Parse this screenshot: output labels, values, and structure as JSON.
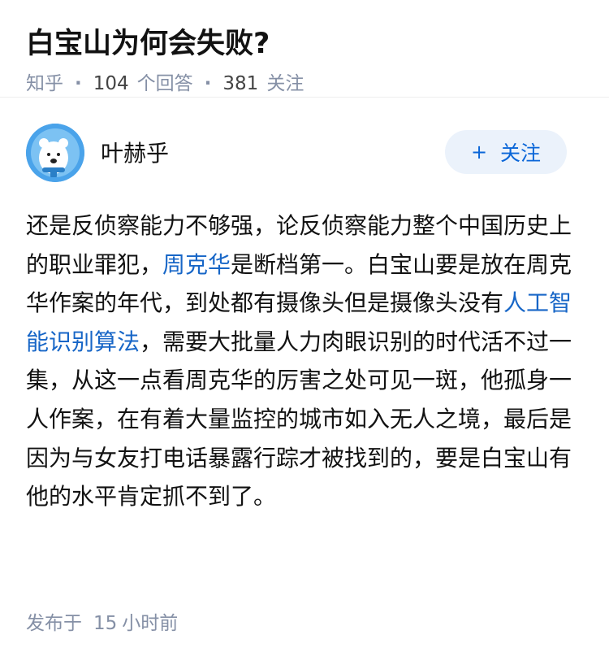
{
  "question": {
    "title": "白宝山为何会失败?",
    "source": "知乎",
    "answers_count": "104",
    "answers_label": "个回答",
    "followers_count": "381",
    "followers_label": "关注",
    "separator": "·"
  },
  "author": {
    "name": "叶赫乎",
    "avatar_icon": "polar-bear-avatar",
    "follow_plus": "+",
    "follow_label": "关注"
  },
  "answer": {
    "segments": [
      {
        "text": "还是反侦察能力不够强，论反侦察能力整个中国历史上的职业罪犯，",
        "link": false
      },
      {
        "text": "周克华",
        "link": true
      },
      {
        "text": "是断档第一。白宝山要是放在周克华作案的年代，到处都有摄像头但是摄像头没有",
        "link": false
      },
      {
        "text": "人工智能识别算法",
        "link": true
      },
      {
        "text": "，需要大批量人力肉眼识别的时代活不过一集，从这一点看周克华的厉害之处可见一斑，他孤身一人作案，在有着大量监控的城市如入无人之境，最后是因为与女友打电话暴露行踪才被找到的，要是白宝山有他的水平肯定抓不到了。",
        "link": false
      }
    ],
    "publish_prefix": "发布于",
    "publish_number": "15",
    "publish_suffix": "小时前"
  },
  "colors": {
    "link": "#1766c7",
    "meta": "#8590a6",
    "follow_bg": "#ebf2fb",
    "follow_text": "#0a66d8",
    "avatar_bg": "#4aa3ea"
  }
}
